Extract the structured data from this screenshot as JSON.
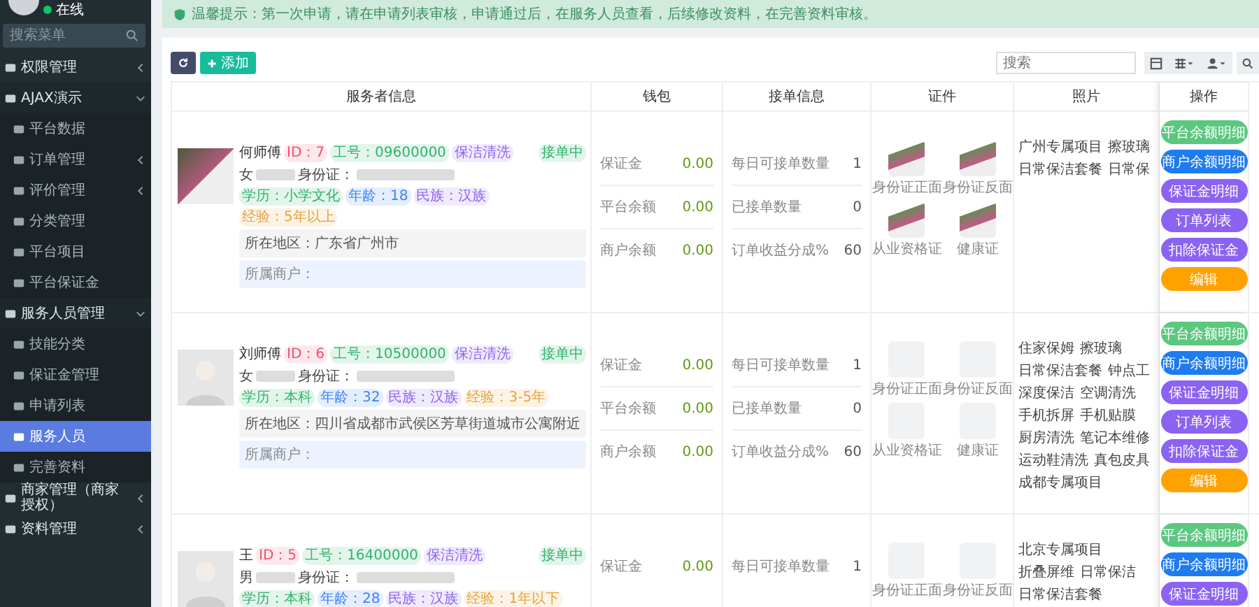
{
  "sidebar": {
    "status": "在线",
    "search": {
      "placeholder": "搜索菜单"
    },
    "items": [
      {
        "label": "权限管理",
        "selected": false,
        "expanded": false
      },
      {
        "label": "AJAX演示",
        "selected": false,
        "expanded": true,
        "children": [
          {
            "label": "平台数据",
            "selected": false
          },
          {
            "label": "订单管理",
            "selected": false,
            "expanded": false
          },
          {
            "label": "评价管理",
            "selected": false,
            "expanded": false
          },
          {
            "label": "分类管理",
            "selected": false
          },
          {
            "label": "平台项目",
            "selected": false
          },
          {
            "label": "平台保证金",
            "selected": false
          }
        ]
      },
      {
        "label": "服务人员管理",
        "selected": false,
        "expanded": true,
        "children": [
          {
            "label": "技能分类",
            "selected": false
          },
          {
            "label": "保证金管理",
            "selected": false
          },
          {
            "label": "申请列表",
            "selected": false
          },
          {
            "label": "服务人员",
            "selected": true
          },
          {
            "label": "完善资料",
            "selected": false
          }
        ]
      },
      {
        "label": "商家管理（商家授权）",
        "selected": false,
        "expanded": false
      },
      {
        "label": "资料管理",
        "selected": false,
        "expanded": false
      }
    ]
  },
  "notice": "温馨提示：第一次申请，请在申请列表审核，申请通过后，在服务人员查看，后续修改资料，在完善资料审核。",
  "toolbar": {
    "add_label": "添加",
    "search": {
      "placeholder": "搜索"
    }
  },
  "table": {
    "columns": [
      "服务者信息",
      "钱包",
      "接单信息",
      "证件",
      "照片",
      "操作"
    ],
    "rows": [
      {
        "kind": "photo",
        "name": "何师傅",
        "tags": [
          {
            "text": "ID：7",
            "color": "#f0506e"
          },
          {
            "text": "工号：09600000",
            "color": "#2fb36b"
          },
          {
            "text": "保洁清洗",
            "color": "#8e63f0"
          }
        ],
        "status": {
          "text": "接单中",
          "color": "#2fb36b"
        },
        "gender": "女",
        "id_label": "身份证：",
        "details": [
          {
            "text": "学历：小学文化",
            "color": "#2fb36b"
          },
          {
            "text": "年龄：18",
            "color": "#3b82f6"
          },
          {
            "text": "民族：汉族",
            "color": "#8e63f0"
          },
          {
            "text": "经验：5年以上",
            "color": "#e6a23c"
          }
        ],
        "region": "所在地区：广东省广州市",
        "merchant": "所属商户：",
        "wallet": [
          {
            "label": "保证金",
            "value": "0.00"
          },
          {
            "label": "平台余额",
            "value": "0.00"
          },
          {
            "label": "商户余额",
            "value": "0.00"
          }
        ],
        "orders": [
          {
            "label": "每日可接单数量",
            "value": "1"
          },
          {
            "label": "已接单数量",
            "value": "0"
          },
          {
            "label": "订单收益分成%",
            "value": "60"
          }
        ],
        "certs": [
          {
            "kind": "image",
            "caption": "身份证正面"
          },
          {
            "kind": "image",
            "caption": "身份证反面"
          },
          {
            "kind": "image",
            "caption": "从业资格证"
          },
          {
            "kind": "image",
            "caption": "健康证"
          }
        ],
        "projects": [
          "广州专属项目",
          "擦玻璃",
          "日常保洁套餐",
          "日常保"
        ],
        "actions": [
          {
            "label": "平台余额明细",
            "color": "#5cc77f"
          },
          {
            "label": "商户余额明细",
            "color": "#1e7bf0"
          },
          {
            "label": "保证金明细",
            "color": "#8b63f2"
          },
          {
            "label": "订单列表",
            "color": "#8b63f2"
          },
          {
            "label": "扣除保证金",
            "color": "#8b63f2"
          },
          {
            "label": "编辑",
            "color": "#ffa200"
          }
        ]
      },
      {
        "kind": "avatar",
        "name": "刘师傅",
        "tags": [
          {
            "text": "ID：6",
            "color": "#f0506e"
          },
          {
            "text": "工号：10500000",
            "color": "#2fb36b"
          },
          {
            "text": "保洁清洗",
            "color": "#8e63f0"
          }
        ],
        "status": {
          "text": "接单中",
          "color": "#2fb36b"
        },
        "gender": "女",
        "id_label": "身份证：",
        "details": [
          {
            "text": "学历：本科",
            "color": "#2fb36b"
          },
          {
            "text": "年龄：32",
            "color": "#3b82f6"
          },
          {
            "text": "民族：汉族",
            "color": "#8e63f0"
          },
          {
            "text": "经验：3-5年",
            "color": "#e6a23c"
          }
        ],
        "region": "所在地区：四川省成都市武侯区芳草街道城市公寓附近",
        "merchant": "所属商户：",
        "wallet": [
          {
            "label": "保证金",
            "value": "0.00"
          },
          {
            "label": "平台余额",
            "value": "0.00"
          },
          {
            "label": "商户余额",
            "value": "0.00"
          }
        ],
        "orders": [
          {
            "label": "每日可接单数量",
            "value": "1"
          },
          {
            "label": "已接单数量",
            "value": "0"
          },
          {
            "label": "订单收益分成%",
            "value": "60"
          }
        ],
        "certs": [
          {
            "kind": "blank",
            "caption": "身份证正面"
          },
          {
            "kind": "blank",
            "caption": "身份证反面"
          },
          {
            "kind": "blank",
            "caption": "从业资格证"
          },
          {
            "kind": "blank",
            "caption": "健康证"
          }
        ],
        "projects": [
          "住家保姆",
          "擦玻璃",
          "日常保洁套餐",
          "钟点工",
          "深度保洁",
          "空调清洗",
          "手机拆屏",
          "手机贴膜",
          "厨房清洗",
          "笔记本维修",
          "运动鞋清洗",
          "真包皮具",
          "成都专属项目"
        ],
        "actions": [
          {
            "label": "平台余额明细",
            "color": "#5cc77f"
          },
          {
            "label": "商户余额明细",
            "color": "#1e7bf0"
          },
          {
            "label": "保证金明细",
            "color": "#8b63f2"
          },
          {
            "label": "订单列表",
            "color": "#8b63f2"
          },
          {
            "label": "扣除保证金",
            "color": "#8b63f2"
          },
          {
            "label": "编辑",
            "color": "#ffa200"
          }
        ]
      },
      {
        "kind": "avatar",
        "name": "王",
        "tags": [
          {
            "text": "ID：5",
            "color": "#f0506e"
          },
          {
            "text": "工号：16400000",
            "color": "#2fb36b"
          },
          {
            "text": "保洁清洗",
            "color": "#8e63f0"
          }
        ],
        "status": {
          "text": "接单中",
          "color": "#2fb36b"
        },
        "gender": "男",
        "id_label": "身份证：",
        "details": [
          {
            "text": "学历：本科",
            "color": "#2fb36b"
          },
          {
            "text": "年龄：28",
            "color": "#3b82f6"
          },
          {
            "text": "民族：汉族",
            "color": "#8e63f0"
          },
          {
            "text": "经验：1年以下",
            "color": "#e6a23c"
          }
        ],
        "wallet": [
          {
            "label": "保证金",
            "value": "0.00"
          }
        ],
        "orders": [
          {
            "label": "每日可接单数量",
            "value": "1"
          }
        ],
        "certs": [
          {
            "kind": "blank",
            "caption": "身份证正面"
          },
          {
            "kind": "blank",
            "caption": "身份证反面"
          }
        ],
        "projects": [
          "北京专属项目",
          "折叠屏维",
          "日常保洁",
          "日常保洁套餐"
        ],
        "actions": [
          {
            "label": "平台余额明细",
            "color": "#5cc77f"
          },
          {
            "label": "商户余额明细",
            "color": "#1e7bf0"
          },
          {
            "label": "保证金明细",
            "color": "#8b63f2"
          }
        ]
      }
    ]
  }
}
